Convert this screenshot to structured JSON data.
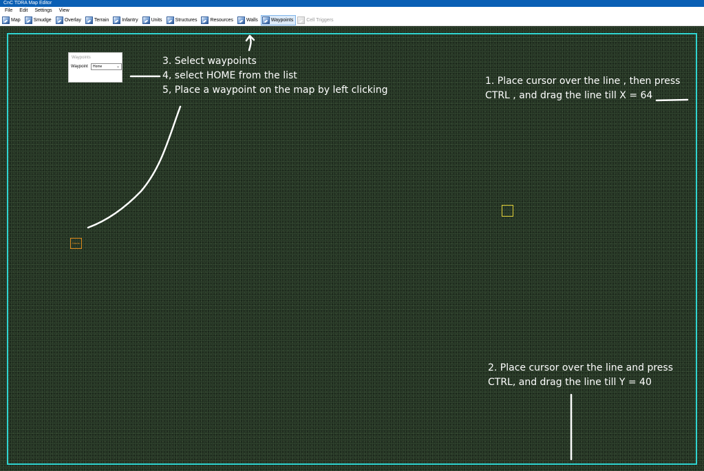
{
  "window": {
    "title": "CnC TDRA Map Editor"
  },
  "menu": [
    {
      "label": "File"
    },
    {
      "label": "Edit"
    },
    {
      "label": "Settings"
    },
    {
      "label": "View"
    }
  ],
  "toolbar": [
    {
      "label": "Map",
      "icon": "map-icon"
    },
    {
      "label": "Smudge",
      "icon": "smudge-icon"
    },
    {
      "label": "Overlay",
      "icon": "overlay-icon"
    },
    {
      "label": "Terrain",
      "icon": "terrain-icon"
    },
    {
      "label": "Infantry",
      "icon": "infantry-icon"
    },
    {
      "label": "Units",
      "icon": "units-icon"
    },
    {
      "label": "Structures",
      "icon": "structures-icon"
    },
    {
      "label": "Resources",
      "icon": "resources-icon"
    },
    {
      "label": "Walls",
      "icon": "walls-icon"
    },
    {
      "label": "Waypoints",
      "icon": "waypoints-icon",
      "active": true
    },
    {
      "label": "Cell Triggers",
      "icon": "cell-triggers-icon",
      "disabled": true
    }
  ],
  "waypoints_panel": {
    "title": "Waypoints",
    "field_label": "Waypoint",
    "selected": "Home"
  },
  "annotations": {
    "step1_line1": "1. Place cursor over the line , then press",
    "step1_line2": "CTRL , and drag the line till X = 64",
    "step2_line1": "2. Place cursor over the line and press",
    "step2_line2": "CTRL, and drag the line till Y = 40",
    "step3": "3. Select waypoints",
    "step4": "4, select HOME from the list",
    "step5": "5, Place a waypoint on the map by left clicking"
  },
  "map": {
    "home_marker_label": "Home",
    "boundary_color": "#2fd4d0",
    "home_marker_color": "#e08a1c",
    "cursor_box_color": "#e6d43a"
  }
}
